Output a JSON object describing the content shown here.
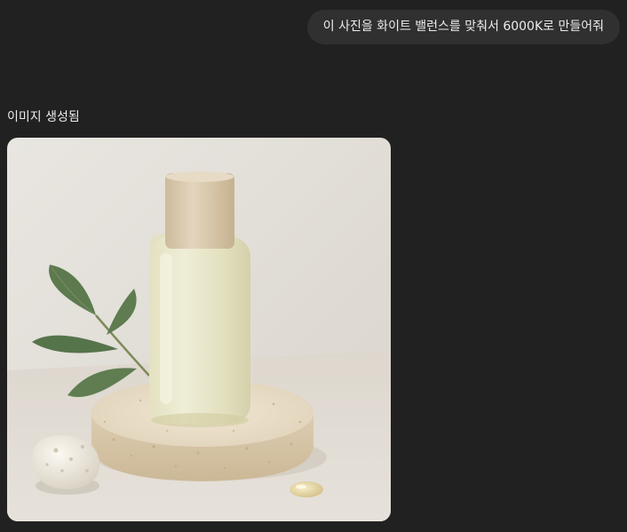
{
  "conversation": {
    "user_message": "이 사진을 화이트 밸런스를 맞춰서 6000K로 만들어줘",
    "assistant": {
      "status_label": "이미지 생성됨",
      "image": {
        "subject": "cosmetic-oil-bottle-product-photo"
      }
    }
  },
  "colors": {
    "background": "#212121",
    "bubble": "#303030",
    "text": "#ececec"
  }
}
